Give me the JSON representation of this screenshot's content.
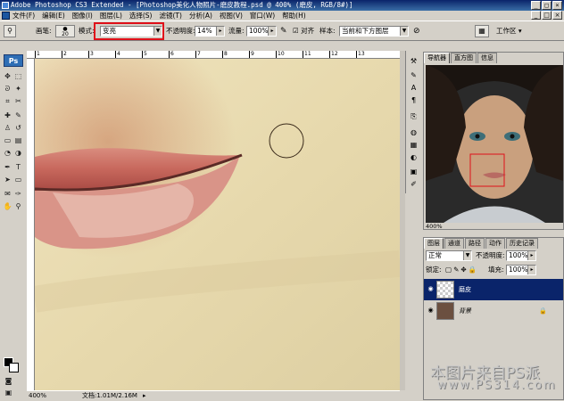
{
  "title_bar": {
    "text": "Adobe Photoshop CS3 Extended - [Photoshop美化人物照片-磨皮教程.psd @ 400% (磨皮, RGB/8#)]"
  },
  "menu": {
    "items": [
      "文件(F)",
      "编辑(E)",
      "图像(I)",
      "图层(L)",
      "选择(S)",
      "滤镜(T)",
      "分析(A)",
      "视图(V)",
      "窗口(W)",
      "帮助(H)"
    ]
  },
  "options": {
    "brush_label": "画笔:",
    "brush_size": "20",
    "mode_label": "模式:",
    "mode_value": "变亮",
    "opacity_label": "不透明度:",
    "opacity_value": "14%",
    "flow_label": "流量:",
    "flow_value": "100%",
    "align_label": "对齐",
    "sample_label": "样本:",
    "sample_value": "当前和下方图层",
    "workspace_label": "工作区"
  },
  "toolbox": {
    "badge": "Ps"
  },
  "status": {
    "zoom": "400%",
    "doc": "文档:1.01M/2.16M"
  },
  "navigator": {
    "tabs": [
      "导航器",
      "直方图",
      "信息"
    ],
    "zoom": "400%"
  },
  "layers": {
    "tabs": [
      "图层",
      "通道",
      "路径",
      "动作",
      "历史记录"
    ],
    "blend_mode": "正常",
    "opacity_label": "不透明度:",
    "opacity_value": "100%",
    "lock_label": "锁定:",
    "fill_label": "填充:",
    "fill_value": "100%",
    "items": [
      {
        "name": "磨皮",
        "selected": true
      },
      {
        "name": "背景",
        "selected": false
      }
    ]
  },
  "watermark": {
    "line1": "本图片来自PS派",
    "line2": "www.PS314.com"
  },
  "colors": {
    "accent": "#0a246a",
    "highlight": "#e0101a"
  }
}
